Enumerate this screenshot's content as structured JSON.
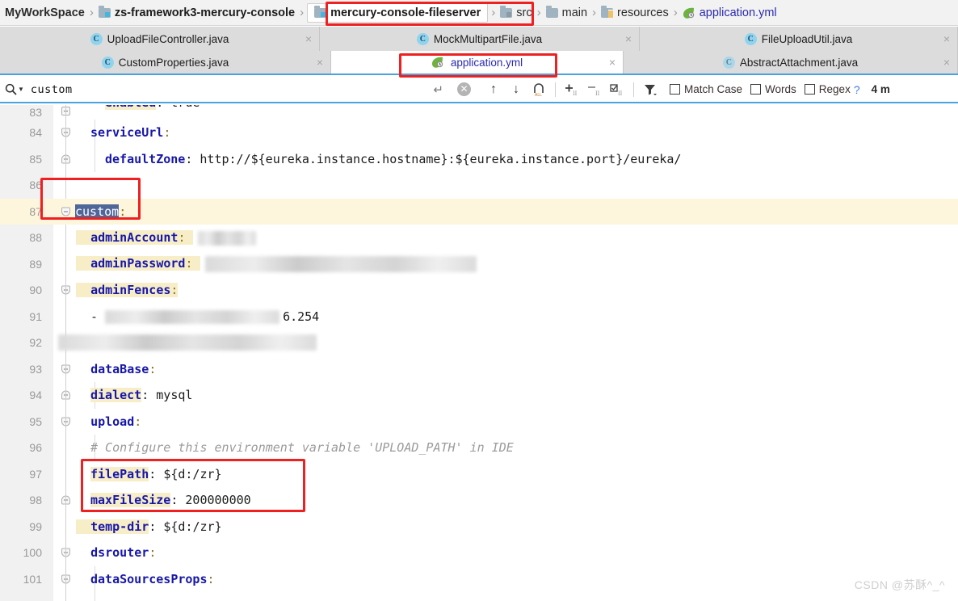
{
  "breadcrumb": {
    "items": [
      {
        "label": "MyWorkSpace",
        "icon": "none",
        "kind": "root"
      },
      {
        "label": "zs-framework3-mercury-console",
        "icon": "module-icon",
        "kind": "module"
      },
      {
        "label": "mercury-console-fileserver",
        "icon": "module-icon",
        "kind": "module",
        "highlighted": true
      },
      {
        "label": "src",
        "icon": "source-folder-icon",
        "kind": "folder"
      },
      {
        "label": "main",
        "icon": "folder-icon",
        "kind": "folder"
      },
      {
        "label": "resources",
        "icon": "resources-folder-icon",
        "kind": "folder"
      },
      {
        "label": "application.yml",
        "icon": "spring-leaf-icon",
        "kind": "file"
      }
    ],
    "separator": "›"
  },
  "tabs": {
    "row1": [
      {
        "label": "UploadFileController.java",
        "icon": "java-class-icon",
        "active": false,
        "close": "×"
      },
      {
        "label": "MockMultipartFile.java",
        "icon": "java-class-icon",
        "active": false,
        "close": "×"
      },
      {
        "label": "FileUploadUtil.java",
        "icon": "java-class-icon",
        "active": false,
        "close": "×"
      }
    ],
    "row2": [
      {
        "label": "CustomProperties.java",
        "icon": "java-class-icon",
        "active": false,
        "close": "×"
      },
      {
        "label": "application.yml",
        "icon": "spring-leaf-icon",
        "active": true,
        "close": "×",
        "highlighted": true
      },
      {
        "label": "AbstractAttachment.java",
        "icon": "java-class-icon",
        "active": false,
        "close": "×"
      }
    ]
  },
  "find": {
    "query": "custom",
    "search_icon": "search-icon",
    "dropdown_icon": "chevron-down-icon",
    "enter_icon": "enter-arrow-icon",
    "clear_icon": "clear-icon",
    "prev_icon": "arrow-up-icon",
    "next_icon": "arrow-down-icon",
    "select_all_icon": "select-all-occurrences-icon",
    "add_icon": "add-occurrence-icon",
    "remove_icon": "remove-occurrence-icon",
    "select_occurrences_icon": "select-occurrences-icon",
    "filter_icon": "filter-icon",
    "match_case_label": "Match Case",
    "words_label": "Words",
    "regex_label": "Regex",
    "help_label": "?",
    "match_count": "4 m"
  },
  "editor": {
    "file": "application.yml",
    "current_line": 87,
    "selection": "custom",
    "lines": [
      {
        "no": "83",
        "fold": "mid",
        "text": "    enabled: true",
        "clipped": true
      },
      {
        "no": "84",
        "fold": "down",
        "text": "  serviceUrl:"
      },
      {
        "no": "85",
        "fold": "up",
        "text": "    defaultZone: http://${eureka.instance.hostname}:${eureka.instance.port}/eureka/"
      },
      {
        "no": "86",
        "fold": "none",
        "text": ""
      },
      {
        "no": "87",
        "fold": "down",
        "text": "custom:"
      },
      {
        "no": "88",
        "fold": "none",
        "text": "  adminAccount:"
      },
      {
        "no": "89",
        "fold": "none",
        "text": "  adminPassword:"
      },
      {
        "no": "90",
        "fold": "down",
        "text": "  adminFences:"
      },
      {
        "no": "91",
        "fold": "none",
        "text": "    - 1??.???.???6.254"
      },
      {
        "no": "92",
        "fold": "none",
        "text": ""
      },
      {
        "no": "93",
        "fold": "down",
        "text": "  dataBase:"
      },
      {
        "no": "94",
        "fold": "up",
        "text": "    dialect: mysql"
      },
      {
        "no": "95",
        "fold": "down",
        "text": "  upload:"
      },
      {
        "no": "96",
        "fold": "none",
        "text": "    # Configure this environment variable 'UPLOAD_PATH' in IDE"
      },
      {
        "no": "97",
        "fold": "none",
        "text": "    filePath: ${d:/zr}"
      },
      {
        "no": "98",
        "fold": "up",
        "text": "    maxFileSize: 200000000"
      },
      {
        "no": "99",
        "fold": "none",
        "text": "  temp-dir: ${d:/zr}"
      },
      {
        "no": "100",
        "fold": "down",
        "text": "  dsrouter:"
      },
      {
        "no": "101",
        "fold": "down",
        "text": "    dataSourcesProps:"
      }
    ],
    "comment_96": "# Configure this environment variable 'UPLOAD_PATH' in IDE",
    "values": {
      "enabled": "true",
      "defaultZone": "http://${eureka.instance.hostname}:${eureka.instance.port}/eureka/",
      "dialect": "mysql",
      "filePath": "${d:/zr}",
      "maxFileSize": "200000000",
      "temp_dir": "${d:/zr}"
    },
    "keys": {
      "enabled": "enabled",
      "serviceUrl": "serviceUrl",
      "defaultZone": "defaultZone",
      "custom": "custom",
      "adminAccount": "adminAccount",
      "adminPassword": "adminPassword",
      "adminFences": "adminFences",
      "dataBase": "dataBase",
      "dialect": "dialect",
      "upload": "upload",
      "filePath": "filePath",
      "maxFileSize": "maxFileSize",
      "temp_dir": "temp-dir",
      "dsrouter": "dsrouter",
      "dataSourcesProps": "dataSourcesProps"
    },
    "redacted_fragments": {
      "password_tail": "……825",
      "fence_tail": "6.254",
      "fence_tail2": "…254"
    }
  },
  "annotations": {
    "color": "#ee2020",
    "boxes": [
      {
        "name": "breadcrumb-module-highlight"
      },
      {
        "name": "active-tab-highlight"
      },
      {
        "name": "custom-key-highlight"
      },
      {
        "name": "upload-paths-highlight"
      }
    ]
  },
  "watermark": "CSDN @苏酥^_^",
  "colors": {
    "accent": "#4aa3df",
    "annotation": "#ee2020",
    "key": "#1717a8",
    "search_highlight": "#f7eec8",
    "current_line": "#fdf6dd",
    "selection": "#4f6699"
  }
}
